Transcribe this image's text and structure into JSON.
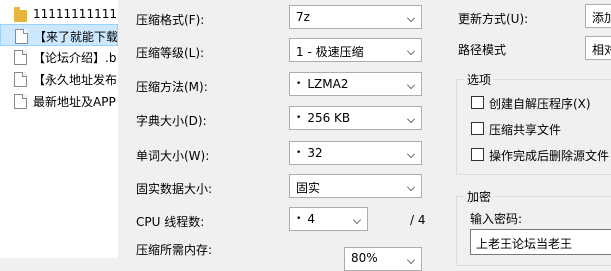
{
  "files": [
    {
      "name": "1111111111111"
    },
    {
      "name": "【来了就能下载"
    },
    {
      "name": "【论坛介绍】.b"
    },
    {
      "name": "【永久地址发布"
    },
    {
      "name": "最新地址及APP"
    }
  ],
  "format": {
    "label": "压缩格式(F):",
    "value": "7z"
  },
  "level": {
    "label": "压缩等级(L):",
    "value": "1 - 极速压缩"
  },
  "method": {
    "label": "压缩方法(M):",
    "value": "LZMA2"
  },
  "dict": {
    "label": "字典大小(D):",
    "value": "256 KB"
  },
  "word": {
    "label": "单词大小(W):",
    "value": "32"
  },
  "solid": {
    "label": "固实数据大小:",
    "value": "固实"
  },
  "threads": {
    "label": "CPU 线程数:",
    "value": "4",
    "total": "/ 4"
  },
  "memory": {
    "label": "压缩所需内存:",
    "value": "80%"
  },
  "update": {
    "label": "更新方式(U):",
    "value": "添加"
  },
  "pathmode": {
    "label": "路径模式",
    "value": "相对"
  },
  "options": {
    "title": "选项",
    "sfx": "创建自解压程序(X)",
    "shared": "压缩共享文件",
    "delete": "操作完成后删除源文件"
  },
  "encryption": {
    "title": "加密",
    "pw_label": "输入密码:",
    "pw_value": "上老王论坛当老王"
  },
  "bullet": "•"
}
